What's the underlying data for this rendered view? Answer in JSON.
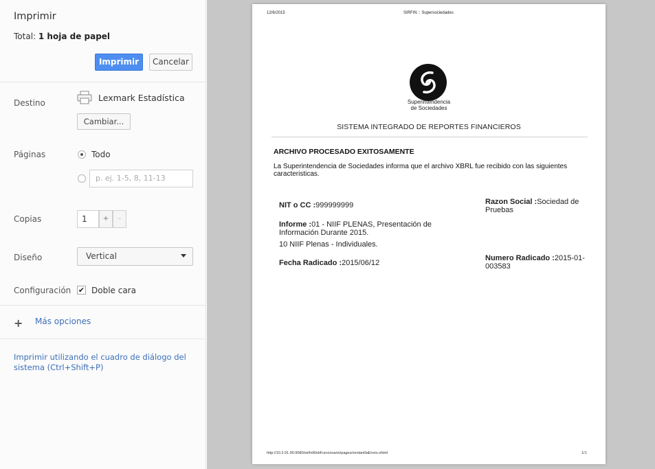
{
  "print_dialog": {
    "title": "Imprimir",
    "total_label": "Total:",
    "total_value": "1 hoja de papel",
    "print_button": "Imprimir",
    "cancel_button": "Cancelar",
    "destination": {
      "label": "Destino",
      "printer_name": "Lexmark Estadística",
      "printer_icon": "printer-icon",
      "change_button": "Cambiar..."
    },
    "pages": {
      "label": "Páginas",
      "option_all": "Todo",
      "selected": "Todo",
      "range_placeholder": "p. ej. 1-5, 8, 11-13"
    },
    "copies": {
      "label": "Copias",
      "value": "1",
      "increment": "+",
      "decrement": "–"
    },
    "layout": {
      "label": "Diseño",
      "value": "Vertical"
    },
    "settings": {
      "label": "Configuración",
      "duplex_label": "Doble cara",
      "duplex_checked": true
    },
    "more_options": "Más opciones",
    "system_dialog_link": "Imprimir utilizando el cuadro de diálogo del sistema (Ctrl+Shift+P)"
  },
  "preview_page": {
    "header_date": "12/6/2015",
    "header_title": "SIRFIN :: Supersociedades",
    "logo_text_1": "Superintendencia",
    "logo_text_2": "de Sociedades",
    "system_title": "SISTEMA INTEGRADO DE REPORTES FINANCIEROS",
    "status_heading": "ARCHIVO PROCESADO EXITOSAMENTE",
    "info_text": "La Superintendencia de Sociedades informa que el archivo XBRL fue recibido con las siguientes caracteristicas.",
    "nit_label": "NIT o CC :",
    "nit_value": "999999999",
    "razon_label": "Razon Social :",
    "razon_value": "Sociedad de Pruebas",
    "informe_label": "Informe :",
    "informe_value": "01 - NIIF PLENAS, Presentación de Información Durante 2015.",
    "informe_line2": "10 NIIF Plenas - Individuales.",
    "fecha_label": "Fecha Radicado :",
    "fecha_value": "2015/06/12",
    "numero_label": "Numero Radicado :",
    "numero_value": "2015-01-003583",
    "footer_url": "http://10.3.91.95:9080/sirfinWebFuncionario/pages/ventanillaEnvio.xhtml",
    "footer_page": "1/1"
  },
  "colors": {
    "primary_button": "#4d8ef0",
    "link": "#3c6fb8",
    "preview_background": "#c7c7c7"
  }
}
